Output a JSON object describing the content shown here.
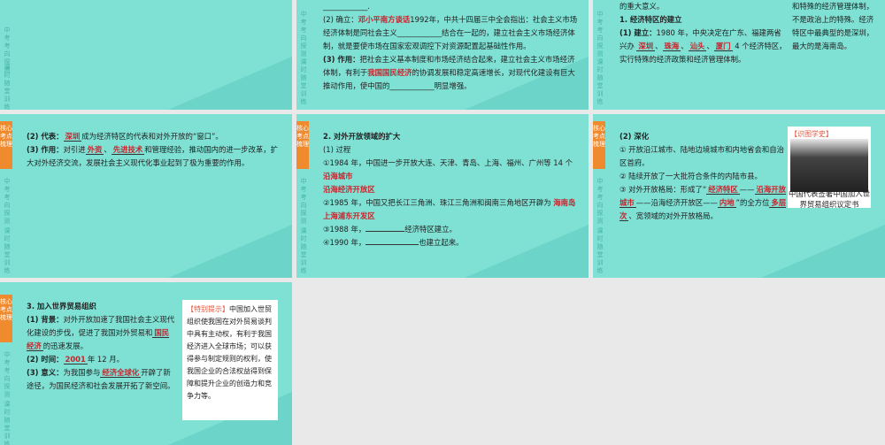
{
  "s1": {
    "line0": "____________.",
    "p2_pre": "(2) 确立：",
    "p2_year": "1992",
    "p2_red": "邓小平南方谈话",
    "p2_mid": "年，中共十四届三中全会指出：社会主义市场经济体制是同社会主义",
    "p2_blank": "____________",
    "p2_post": "结合在一起的，建立社会主义市场经济体制，就是要使市场在国家宏观调控下对资源配置起基础性作用。",
    "p3_label": "(3) 作用：",
    "p3_text1": "把社会主义基本制度和市场经济结合起来，建立社会主义市场经济体制，有利于",
    "p3_red": "我国国民经济",
    "p3_text2": "的协调发展和稳定高速增长，对现代化建设有巨大推动作用，使中国的",
    "p3_blank": "____________",
    "p3_post": "明显增强。"
  },
  "s2": {
    "l0": "的重大意义。",
    "h1": "1. 经济特区的建立",
    "p1_label": "(1) 建立：",
    "p1_text": "1980 年，中央决定在广东、福建两省兴办",
    "cities": [
      "深圳",
      "珠海",
      "汕头",
      "厦门"
    ],
    "p1_post": "4 个经济特区，实行特殊的经济政策和经济管理体制。",
    "right_text": "和特殊的经济管理体制，不是政治上的特殊。经济特区中最典型的是深圳，最大的是海南岛。"
  },
  "s3": {
    "p2_label": "(2) 代表：",
    "p2_red": "深圳",
    "p2_post": "成为经济特区的代表和对外开放的“窗口”。",
    "p3_label": "(3) 作用：",
    "p3_pre": "对引进",
    "p3_r1": "外资",
    "p3_r2": "先进技术",
    "p3_post": "和管理经验，推动国内的进一步改革，扩大对外经济交流，发展社会主义现代化事业起到了极为重要的作用。"
  },
  "s4": {
    "h": "2. 对外开放领域的扩大",
    "sub": "(1) 过程",
    "i1": "①1984 年，中国进一步开放大连、天津、青岛、上海、福州、广州等 14 个",
    "i1_red": "沿海城市",
    "i2_red": "沿海经济开放区",
    "i2": "②1985 年，中国又把长江三角洲、珠江三角洲和闽南三角地区开辟为",
    "i2_red2": "海南岛",
    "i3_red": "上海浦东开发区",
    "i4": "③1988 年，",
    "i4_post": "经济特区建立。",
    "i5": "④1990 年，",
    "i5_post": "也建立起来。"
  },
  "s5": {
    "h": "(2) 深化",
    "i1": "① 开放沿江城市、陆地边境城市和内地省会和自治区首府。",
    "i2": "② 陆续开放了一大批符合条件的内陆市县。",
    "i3_pre": "③ 对外开放格局：形成了“",
    "i3_r1": "经济特区",
    "i3_r2": "沿海开放城市",
    "i3_mid": "——沿海经济开放区——",
    "i3_r3": "内地",
    "i3_post1": "”的全方位",
    "i3_r4": "多层次",
    "i3_post2": "、宽领域的对外开放格局。",
    "photo_label": "【识图学史】",
    "photo_caption": "中国代表签署中国加入世界贸易组织议定书"
  },
  "s6": {
    "h": "3. 加入世界贸易组织",
    "p1_label": "(1) 背景：",
    "p1_text": "对外开放加速了我国社会主义现代化建设的步伐，促进了我国对外贸易和",
    "p1_red": "国民经济",
    "p1_post": "的迅速发展。",
    "p2_label": "(2) 时间：",
    "p2_red": "2001",
    "p2_post": "年 12 月。",
    "p3_label": "(3) 意义：",
    "p3_pre": "为我国参与",
    "p3_red": "经济全球化",
    "p3_post": "开辟了新途径，为国民经济和社会发展开拓了新空间。",
    "tip_label": "【特别提示】",
    "tip_text": "中国加入世贸组织使我国在对外贸易谈判中具有主动权，有利于我国经济进入全球市场；可以获得参与制定规则的权利，使我国企业的合法权益得到保障和提升企业的创造力和竞争力等。"
  },
  "side": {
    "tab": "核心考点梳理",
    "vt1": "中考考向探测",
    "vt2": "课时随堂训练"
  }
}
